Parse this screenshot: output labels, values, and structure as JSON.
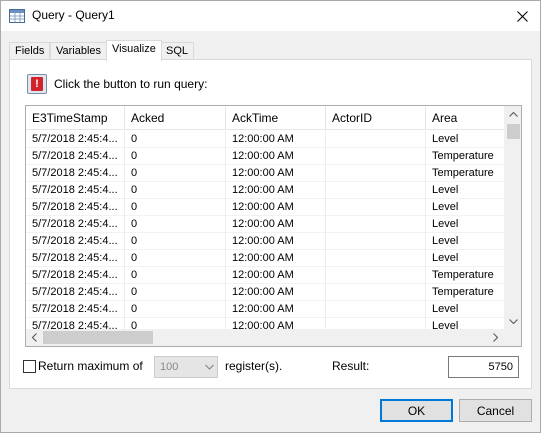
{
  "window": {
    "title": "Query - Query1"
  },
  "tabs": [
    {
      "label": "Fields",
      "active": false
    },
    {
      "label": "Variables",
      "active": false
    },
    {
      "label": "Visualize",
      "active": true
    },
    {
      "label": "SQL",
      "active": false
    }
  ],
  "run": {
    "icon": "alert-run-icon",
    "icon_glyph": "!",
    "label": "Click the button to run query:"
  },
  "grid": {
    "columns": [
      "E3TimeStamp",
      "Acked",
      "AckTime",
      "ActorID",
      "Area"
    ],
    "rows": [
      [
        "5/7/2018 2:45:4...",
        "0",
        "12:00:00 AM",
        "",
        "Level"
      ],
      [
        "5/7/2018 2:45:4...",
        "0",
        "12:00:00 AM",
        "",
        "Temperature"
      ],
      [
        "5/7/2018 2:45:4...",
        "0",
        "12:00:00 AM",
        "",
        "Temperature"
      ],
      [
        "5/7/2018 2:45:4...",
        "0",
        "12:00:00 AM",
        "",
        "Level"
      ],
      [
        "5/7/2018 2:45:4...",
        "0",
        "12:00:00 AM",
        "",
        "Level"
      ],
      [
        "5/7/2018 2:45:4...",
        "0",
        "12:00:00 AM",
        "",
        "Level"
      ],
      [
        "5/7/2018 2:45:4...",
        "0",
        "12:00:00 AM",
        "",
        "Level"
      ],
      [
        "5/7/2018 2:45:4...",
        "0",
        "12:00:00 AM",
        "",
        "Level"
      ],
      [
        "5/7/2018 2:45:4...",
        "0",
        "12:00:00 AM",
        "",
        "Temperature"
      ],
      [
        "5/7/2018 2:45:4...",
        "0",
        "12:00:00 AM",
        "",
        "Temperature"
      ],
      [
        "5/7/2018 2:45:4...",
        "0",
        "12:00:00 AM",
        "",
        "Level"
      ],
      [
        "5/7/2018 2:45:4...",
        "0",
        "12:00:00 AM",
        "",
        "Level"
      ]
    ]
  },
  "options": {
    "return_max_label": "Return maximum of",
    "return_max_checked": false,
    "max_value": "100",
    "registers_label": "register(s).",
    "result_label": "Result:",
    "result_value": "5750"
  },
  "buttons": {
    "ok": "OK",
    "cancel": "Cancel"
  },
  "colors": {
    "alert_red": "#d3232a",
    "accent": "#0078d7"
  }
}
